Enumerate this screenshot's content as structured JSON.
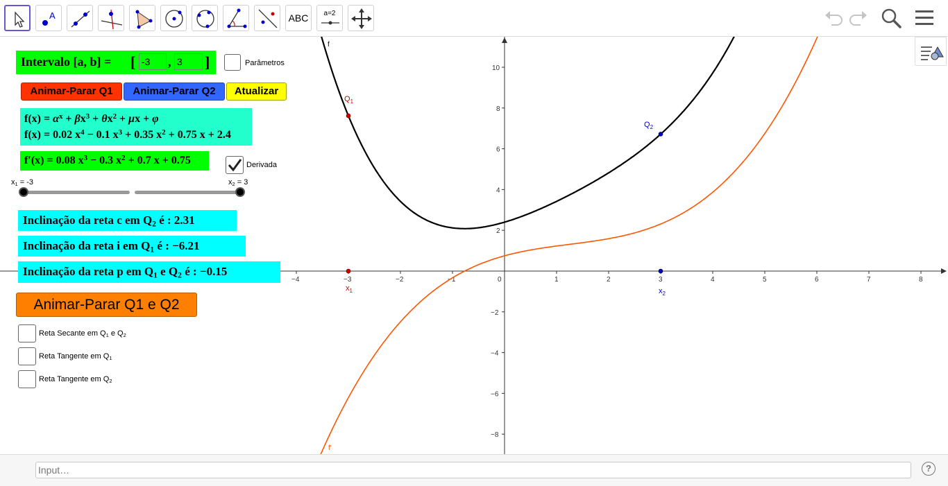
{
  "toolbar": {
    "tools": [
      {
        "name": "move-tool",
        "active": true
      },
      {
        "name": "point-tool"
      },
      {
        "name": "line-tool"
      },
      {
        "name": "perpendicular-line-tool"
      },
      {
        "name": "polygon-tool"
      },
      {
        "name": "circle-center-point-tool"
      },
      {
        "name": "circle-three-points-tool"
      },
      {
        "name": "angle-tool"
      },
      {
        "name": "reflect-tool"
      },
      {
        "name": "text-tool",
        "label": "ABC"
      },
      {
        "name": "slider-tool",
        "label": "a=2"
      },
      {
        "name": "move-graphics-view-tool"
      }
    ],
    "right": [
      "undo-icon",
      "redo-icon",
      "search-icon",
      "menu-icon"
    ]
  },
  "interval": {
    "label": "Intervalo [a, b] =",
    "a": "-3",
    "b": "3",
    "open_bracket": "[",
    "close_bracket": "]",
    "comma": ","
  },
  "parametros_label": "Parâmetros",
  "buttons": {
    "animar_q1": "Animar-Parar Q1",
    "animar_q2": "Animar-Parar Q2",
    "atualizar": "Atualizar",
    "animar_q1_q2": "Animar-Parar Q1 e Q2"
  },
  "colors": {
    "q1_button": "#ff3300",
    "q2_button": "#3366ff",
    "atualizar_button": "#ffff00",
    "animar_both_button": "#ff7f00",
    "curve_f": "#000000",
    "curve_fprime": "#ff5500",
    "q1": "#cc0000",
    "q2": "#0000cc"
  },
  "formulas": {
    "general": "f(x) = αx + βx3 + θx2 + μx + φ",
    "f": "f(x) = 0.02 x4 − 0.1 x3 + 0.35 x2 + 0.75 x + 2.4",
    "fprime": "f′(x) = 0.08 x3 − 0.3 x2 + 0.7 x + 0.75"
  },
  "derivada_label": "Derivada",
  "sliders": {
    "x1_label": "x1 = -3",
    "x2_label": "x2 = 3"
  },
  "slopes": {
    "c": "Inclinação da reta c em Q2 é : 2.31",
    "i": "Inclinação da reta i em Q1 é : −6.21",
    "p": "Inclinação da reta p em Q1 e Q2 é : −0.15"
  },
  "checkboxes": {
    "secante": "Reta Secante em Q1 e Q2",
    "tangente_q1": "Reta Tangente em Q1",
    "tangente_q2": "Reta Tangente em Q2"
  },
  "graph": {
    "x_ticks": [
      "−4",
      "−3",
      "−2",
      "−1",
      "0",
      "1",
      "2",
      "3",
      "4",
      "5",
      "6",
      "7",
      "8"
    ],
    "y_ticks": [
      "10",
      "8",
      "6",
      "4",
      "2",
      "−2",
      "−4",
      "−6",
      "−8"
    ],
    "curve_f_label": "f",
    "curve_fprime_label": "f'",
    "q1_label": "Q1",
    "q2_label": "Q2",
    "x1_label": "x1",
    "x2_label": "x2"
  },
  "input_bar": {
    "placeholder": "Input…",
    "help": "?"
  }
}
